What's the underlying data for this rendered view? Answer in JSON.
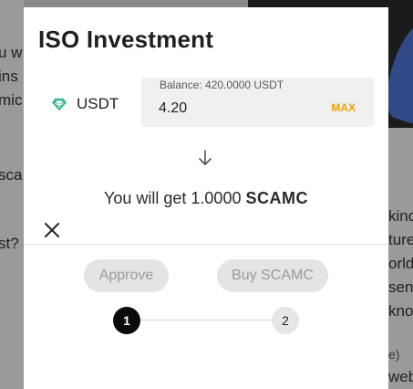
{
  "background": {
    "left_fragments": [
      "u w",
      "ins",
      "mic",
      "sca",
      "st?"
    ],
    "right_fragments": [
      "kind",
      "ture",
      "orld",
      "sent",
      "kno",
      "e)",
      "web"
    ]
  },
  "modal": {
    "title": "ISO Investment",
    "token": {
      "icon": "tether-icon",
      "label": "USDT",
      "color": "#3ab795"
    },
    "balance_label": "Balance: 420.0000 USDT",
    "amount_value": "4.20",
    "max_label": "MAX",
    "result": {
      "prefix": "You will get 1.0000",
      "token": "SCAMC"
    },
    "buttons": {
      "approve": "Approve",
      "buy": "Buy SCAMC"
    },
    "steps": [
      "1",
      "2"
    ],
    "current_step": 1
  },
  "colors": {
    "accent": "#f0a000",
    "disabled_bg": "#e4e4e4",
    "disabled_text": "#9a9a9a"
  }
}
